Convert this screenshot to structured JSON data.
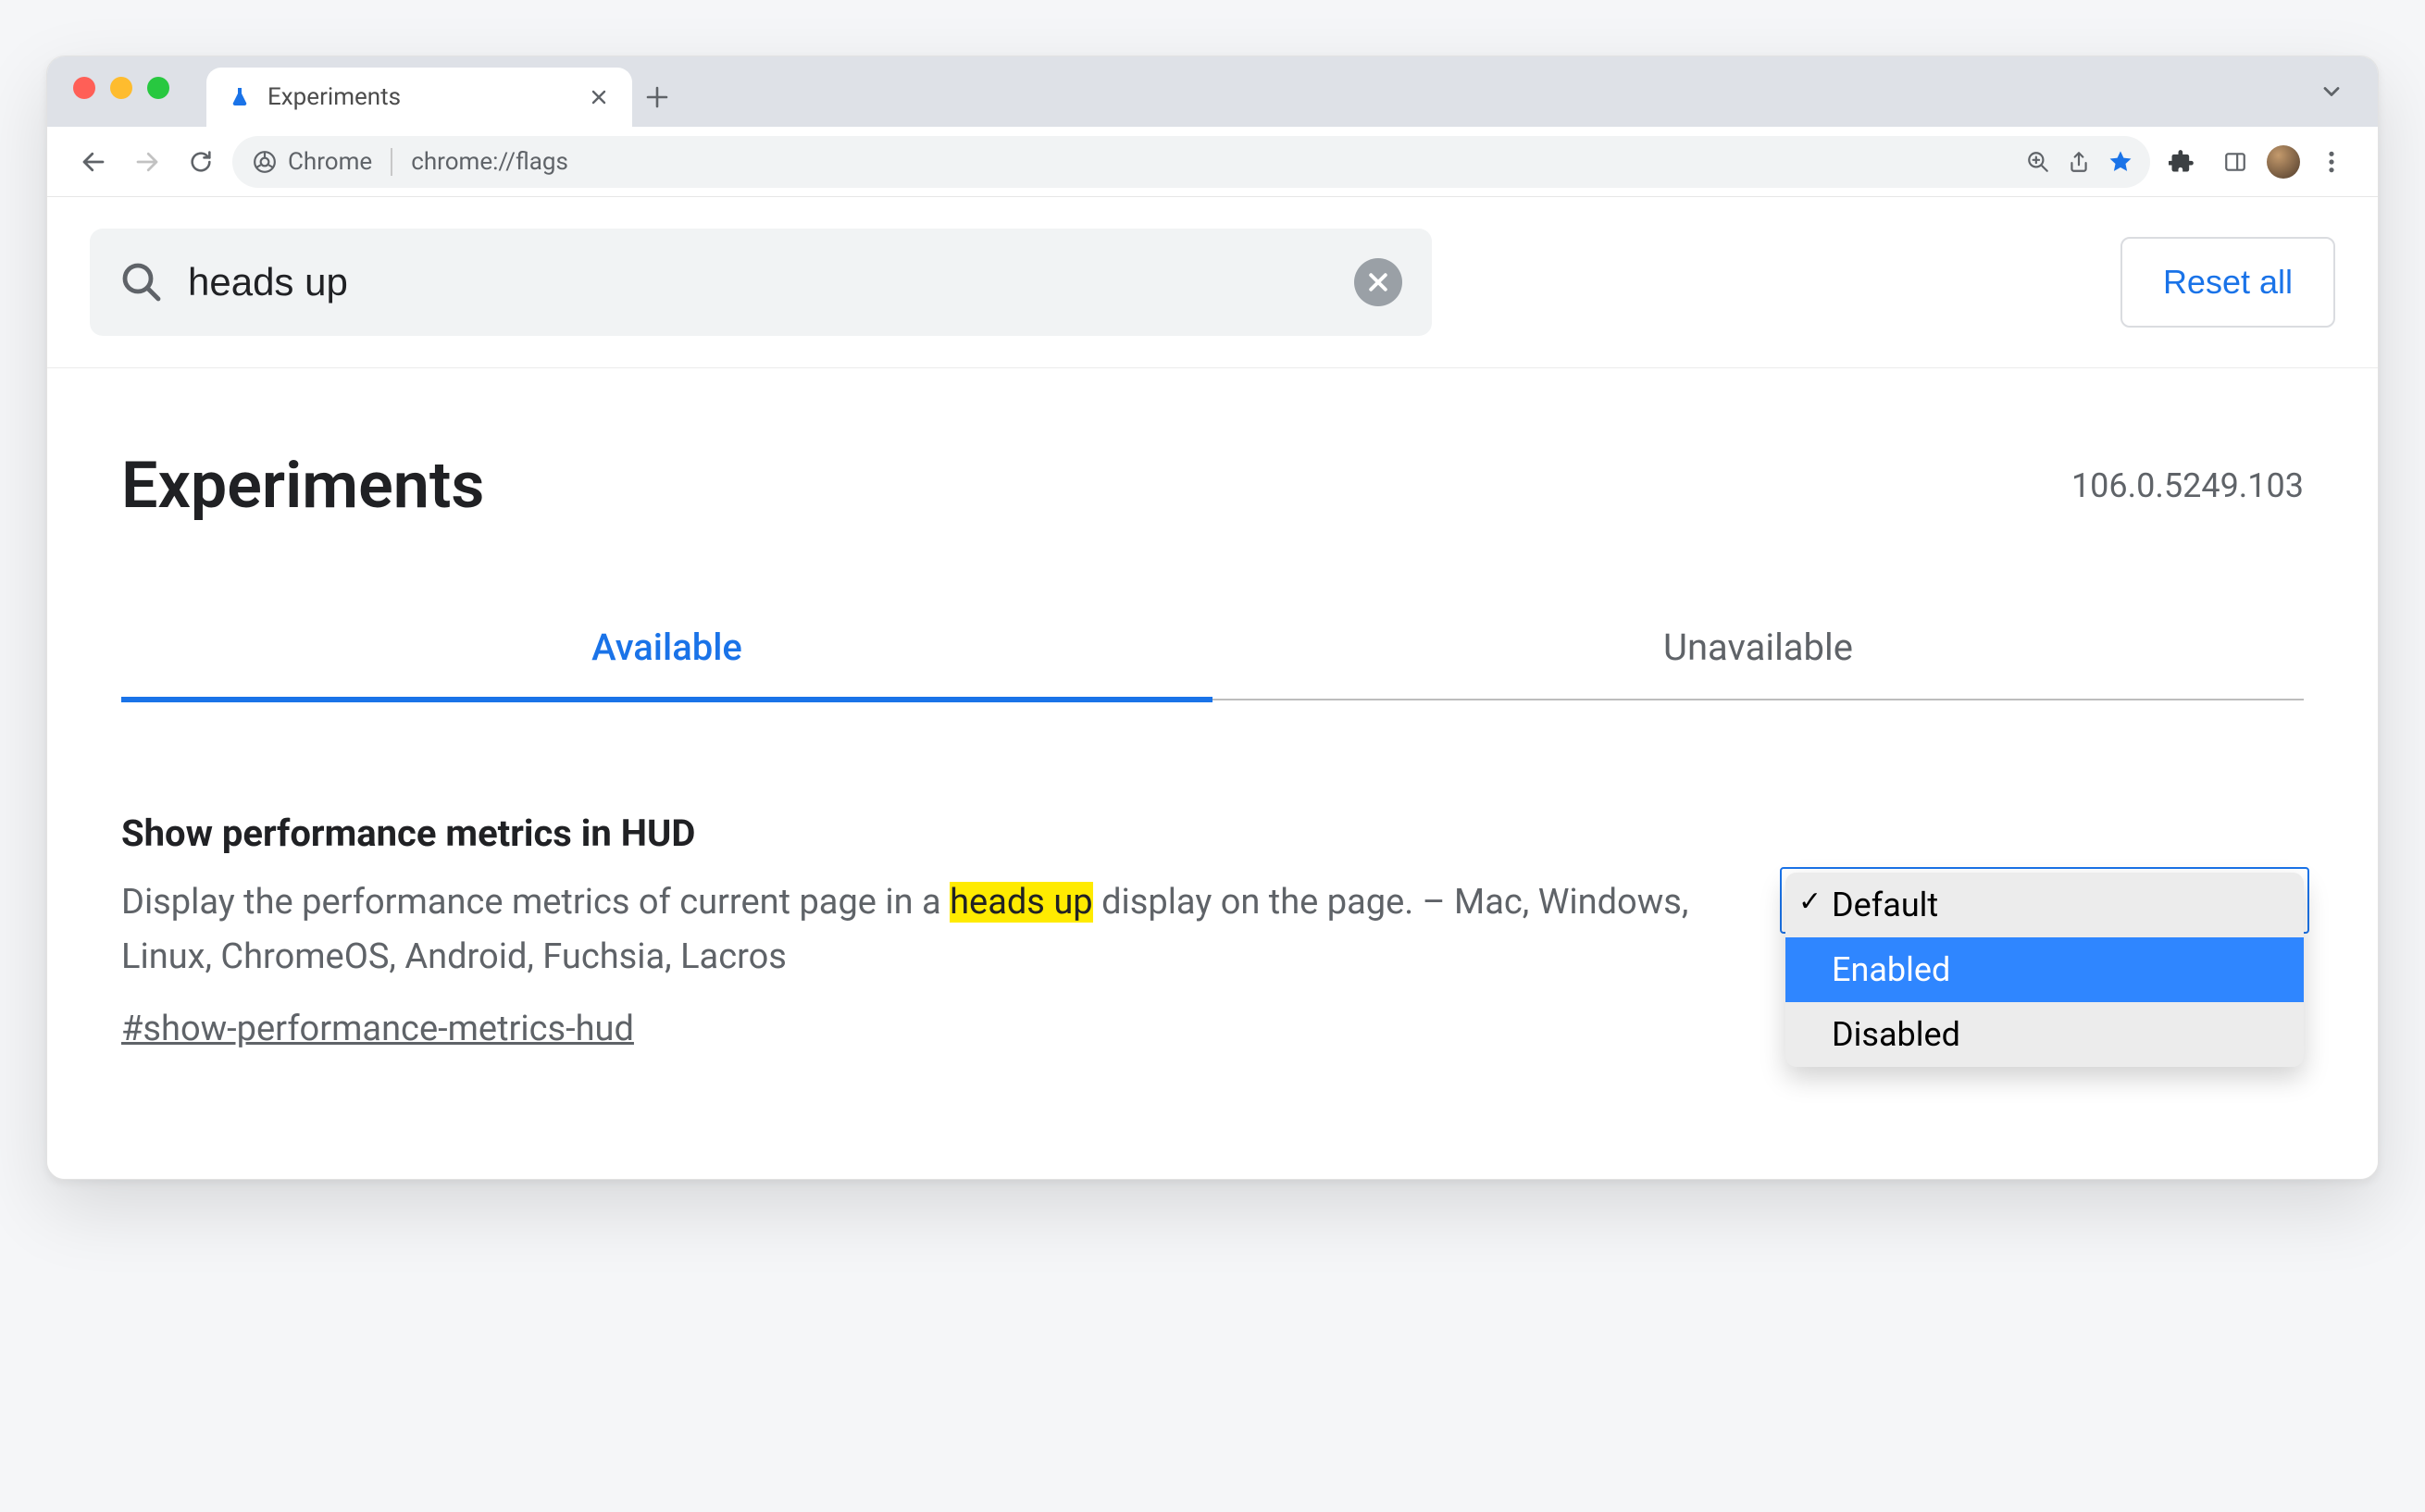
{
  "window": {
    "tab_title": "Experiments",
    "omnibox_chip": "Chrome",
    "url": "chrome://flags"
  },
  "search": {
    "value": "heads up",
    "reset_label": "Reset all"
  },
  "header": {
    "title": "Experiments",
    "version": "106.0.5249.103"
  },
  "tabs": {
    "available": "Available",
    "unavailable": "Unavailable"
  },
  "flag": {
    "title": "Show performance metrics in HUD",
    "desc_pre": "Display the performance metrics of current page in a ",
    "desc_hl": "heads up",
    "desc_post": " display on the page. – Mac, Windows, Linux, ChromeOS, Android, Fuchsia, Lacros",
    "anchor": "#show-performance-metrics-hud",
    "options": {
      "default": "Default",
      "enabled": "Enabled",
      "disabled": "Disabled"
    }
  }
}
